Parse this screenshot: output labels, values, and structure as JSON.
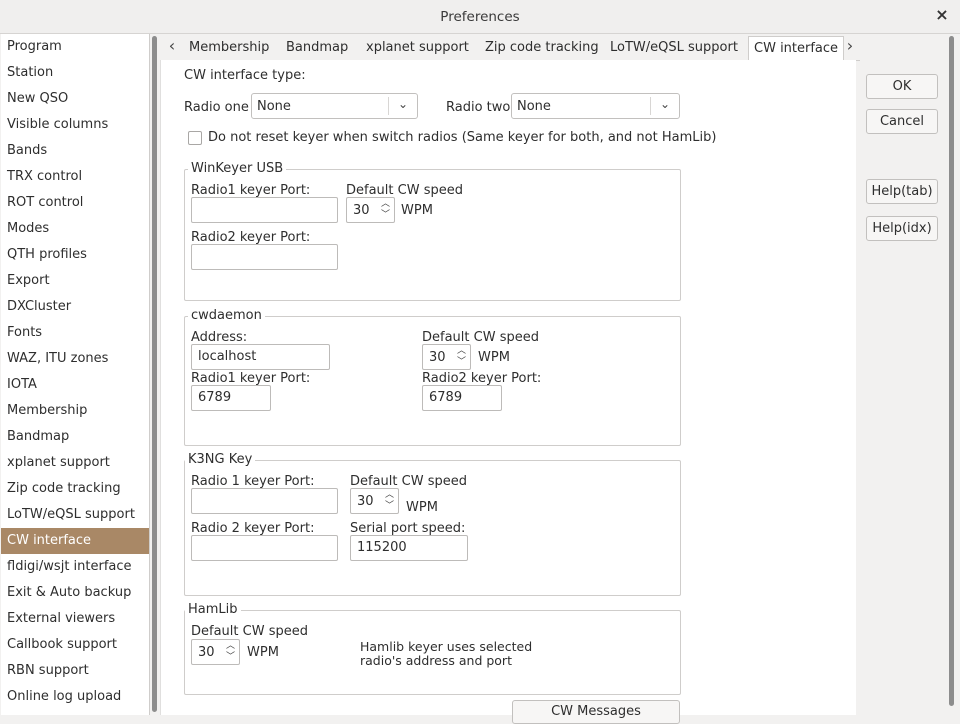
{
  "window": {
    "title": "Preferences",
    "close_glyph": "×"
  },
  "sidebar": {
    "items": [
      "Program",
      "Station",
      "New QSO",
      "Visible columns",
      "Bands",
      "TRX control",
      "ROT control",
      "Modes",
      "QTH profiles",
      "Export",
      "DXCluster",
      "Fonts",
      "WAZ, ITU zones",
      "IOTA",
      "Membership",
      "Bandmap",
      "xplanet support",
      "Zip code tracking",
      "LoTW/eQSL support",
      "CW interface",
      "fldigi/wsjt interface",
      "Exit & Auto backup",
      "External viewers",
      "Callbook support",
      "RBN support",
      "Online log upload"
    ],
    "selected_index": 19,
    "selected_color": "#a98866"
  },
  "tabs": {
    "left_arrow": "‹",
    "right_arrow": "›",
    "items": [
      "Membership",
      "Bandmap",
      "xplanet support",
      "Zip code tracking",
      "LoTW/eQSL support",
      "CW interface"
    ],
    "active": "CW interface"
  },
  "cw": {
    "type_label": "CW interface type:",
    "radio_one_label": "Radio one",
    "radio_one_value": "None",
    "radio_two_label": "Radio two",
    "radio_two_value": "None",
    "no_reset_label": "Do not reset keyer when switch radios (Same keyer for both, and not HamLib)",
    "winkeyer": {
      "title": "WinKeyer USB",
      "radio1_port_label": "Radio1 keyer Port:",
      "radio1_port_value": "",
      "default_speed_label": "Default CW speed",
      "speed_value": "30",
      "wpm": "WPM",
      "radio2_port_label": "Radio2 keyer Port:",
      "radio2_port_value": ""
    },
    "cwdaemon": {
      "title": "cwdaemon",
      "address_label": "Address:",
      "address_value": "localhost",
      "default_speed_label": "Default CW speed",
      "speed_value": "30",
      "wpm": "WPM",
      "radio1_port_label": "Radio1 keyer Port:",
      "radio1_port_value": "6789",
      "radio2_port_label": "Radio2 keyer Port:",
      "radio2_port_value": "6789"
    },
    "k3ng": {
      "title": "K3NG Key",
      "radio1_port_label": "Radio 1 keyer Port:",
      "radio1_port_value": "",
      "default_speed_label": "Default CW speed",
      "speed_value": "30",
      "wpm": "WPM",
      "radio2_port_label": "Radio 2 keyer Port:",
      "radio2_port_value": "",
      "serial_speed_label": "Serial port speed:",
      "serial_speed_value": "115200"
    },
    "hamlib": {
      "title": "HamLib",
      "default_speed_label": "Default CW speed",
      "speed_value": "30",
      "wpm": "WPM",
      "note_line1": "Hamlib keyer uses selected",
      "note_line2": "radio's address and port"
    },
    "cw_messages_button": "CW Messages"
  },
  "buttons": {
    "ok": "OK",
    "cancel": "Cancel",
    "help_tab": "Help(tab)",
    "help_idx": "Help(idx)"
  }
}
